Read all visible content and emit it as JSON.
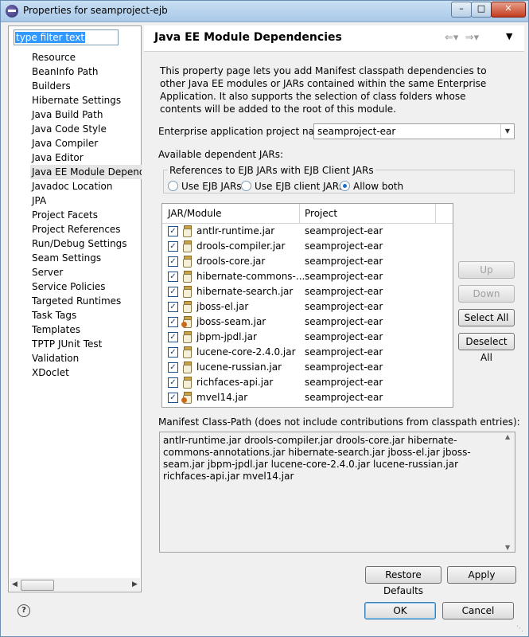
{
  "window": {
    "title": "Properties for seamproject-ejb"
  },
  "filter": {
    "value": "type filter text"
  },
  "nav": [
    "Resource",
    "BeanInfo Path",
    "Builders",
    "Hibernate Settings",
    "Java Build Path",
    "Java Code Style",
    "Java Compiler",
    "Java Editor",
    "Java EE Module Dependen",
    "Javadoc Location",
    "JPA",
    "Project Facets",
    "Project References",
    "Run/Debug Settings",
    "Seam Settings",
    "Server",
    "Service Policies",
    "Targeted Runtimes",
    "Task Tags",
    "Templates",
    "TPTP JUnit Test",
    "Validation",
    "XDoclet"
  ],
  "nav_selected_index": 8,
  "page": {
    "title": "Java EE Module Dependencies",
    "description": "This property page lets you add Manifest classpath dependencies to other Java EE modules or JARs contained within the same Enterprise Application. It also supports the selection of class folders whose contents will be added to the root of this module.",
    "ear_label": "Enterprise application project name:",
    "ear_value": "seamproject-ear",
    "available_label": "Available dependent JARs:",
    "group_label": "References to EJB JARs with EJB Client JARs",
    "radios": [
      "Use EJB JARs",
      "Use EJB client JARs",
      "Allow both"
    ],
    "radio_selected": 2
  },
  "table": {
    "col_module": "JAR/Module",
    "col_project": "Project",
    "rows": [
      {
        "name": "antlr-runtime.jar",
        "project": "seamproject-ear",
        "checked": "✓"
      },
      {
        "name": "drools-compiler.jar",
        "project": "seamproject-ear",
        "checked": "✓"
      },
      {
        "name": "drools-core.jar",
        "project": "seamproject-ear",
        "checked": "✓"
      },
      {
        "name": "hibernate-commons-...",
        "project": "seamproject-ear",
        "checked": "✓"
      },
      {
        "name": "hibernate-search.jar",
        "project": "seamproject-ear",
        "checked": "✓"
      },
      {
        "name": "jboss-el.jar",
        "project": "seamproject-ear",
        "checked": "✓"
      },
      {
        "name": "jboss-seam.jar",
        "project": "seamproject-ear",
        "checked": "✓"
      },
      {
        "name": "jbpm-jpdl.jar",
        "project": "seamproject-ear",
        "checked": "✓"
      },
      {
        "name": "lucene-core-2.4.0.jar",
        "project": "seamproject-ear",
        "checked": "✓"
      },
      {
        "name": "lucene-russian.jar",
        "project": "seamproject-ear",
        "checked": "✓"
      },
      {
        "name": "richfaces-api.jar",
        "project": "seamproject-ear",
        "checked": "✓"
      },
      {
        "name": "mvel14.jar",
        "project": "seamproject-ear",
        "checked": "✓"
      }
    ]
  },
  "side_buttons": {
    "up": "Up",
    "down": "Down",
    "select_all": "Select All",
    "deselect_all": "Deselect All"
  },
  "manifest": {
    "label": "Manifest Class-Path (does not include contributions from classpath entries):",
    "text": "antlr-runtime.jar drools-compiler.jar drools-core.jar hibernate-commons-annotations.jar hibernate-search.jar jboss-el.jar jboss-seam.jar jbpm-jpdl.jar lucene-core-2.4.0.jar lucene-russian.jar richfaces-api.jar mvel14.jar"
  },
  "buttons": {
    "restore": "Restore Defaults",
    "apply": "Apply",
    "ok": "OK",
    "cancel": "Cancel"
  }
}
